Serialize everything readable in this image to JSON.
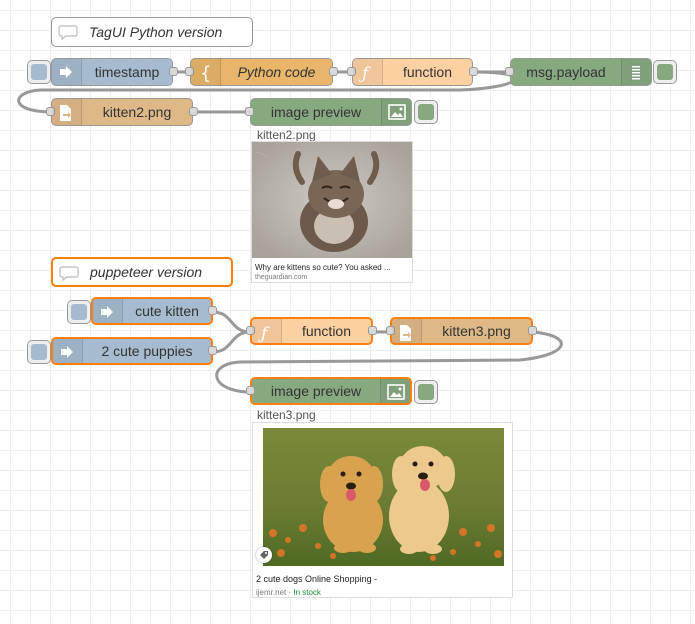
{
  "colors": {
    "inject": "#a6bbcf",
    "template": "#e8b56a",
    "function": "#fdd0a2",
    "debug": "#87a980",
    "file_in": "#deb887",
    "image_preview": "#87a980",
    "selected": "#ff7f0e",
    "wire": "#999999"
  },
  "comments": {
    "tagui": "TagUI Python version",
    "puppeteer": "puppeteer version"
  },
  "nodes": {
    "timestamp": "timestamp",
    "python_code": "Python code",
    "function_1": "function",
    "msg_payload": "msg.payload",
    "kitten2": "kitten2.png",
    "image_preview_1": "image preview",
    "cute_kitten": "cute kitten",
    "cute_puppies": "2 cute puppies",
    "function_2": "function",
    "kitten3": "kitten3.png",
    "image_preview_2": "image preview"
  },
  "previews": {
    "first": {
      "filename": "kitten2.png",
      "caption": "Why are kittens so cute? You asked ...",
      "source": "theguardian.com"
    },
    "second": {
      "filename": "kitten3.png",
      "caption": "2 cute dogs Online Shopping -",
      "source": "ijemr.net",
      "separator": " · ",
      "stock": "In stock"
    }
  },
  "icons": {
    "inject": "arrow-in-icon",
    "template": "brace-icon",
    "function": "function-icon",
    "debug": "list-icon",
    "file": "file-icon",
    "image": "image-icon",
    "comment": "comment-icon"
  }
}
